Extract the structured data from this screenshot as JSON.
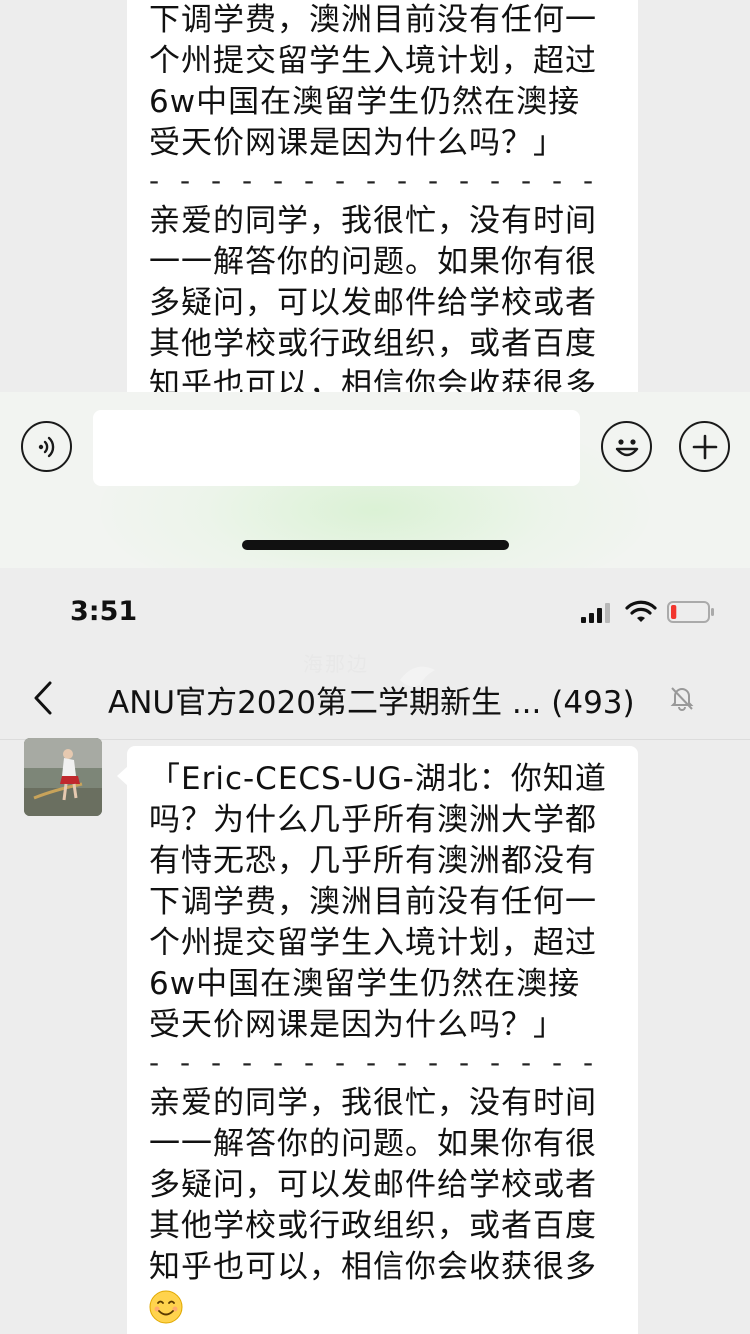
{
  "status_bar": {
    "time": "3:51",
    "battery_level": 0.15
  },
  "nav": {
    "title": "ANU官方2020第二学期新生 ...",
    "member_count": "(493)",
    "watermark": "海那边"
  },
  "input_bar": {
    "value": "",
    "placeholder": ""
  },
  "message": {
    "quote": "「Eric-CECS-UG-湖北：你知道吗？为什么几乎所有澳洲大学都有恃无恐，几乎所有澳洲都没有下调学费，澳洲目前没有任何一个州提交留学生入境计划，超过6w中国在澳留学生仍然在澳接受天价网课是因为什么吗？」",
    "quote_lines": [
      "「Eric-CECS-UG-湖北：你知道",
      "吗？为什么几乎所有澳洲大学都",
      "有恃无恐，几乎所有澳洲都没有",
      "下调学费，澳洲目前没有任何一",
      "个州提交留学生入境计划，超过",
      "6w中国在澳留学生仍然在澳接",
      "受天价网课是因为什么吗？」"
    ],
    "divider": "- - - - - - - - - - - - - - -",
    "reply_lines": [
      "亲爱的同学，我很忙，没有时间",
      "一一解答你的问题。如果你有很",
      "多疑问，可以发邮件给学校或者",
      "其他学校或行政组织，或者百度",
      "知乎也可以，相信你会收获很多"
    ],
    "top_quote_lines": [
      "下调学费，澳洲目前没有任何一",
      "个州提交留学生入境计划，超过",
      "6w中国在澳留学生仍然在澳接",
      "受天价网课是因为什么吗？」"
    ],
    "emoji": "smiling-face"
  },
  "icons": [
    "voice-icon",
    "emoji-icon",
    "plus-icon",
    "back-chevron-icon",
    "mute-bell-icon",
    "signal-icon",
    "wifi-icon",
    "battery-icon"
  ]
}
